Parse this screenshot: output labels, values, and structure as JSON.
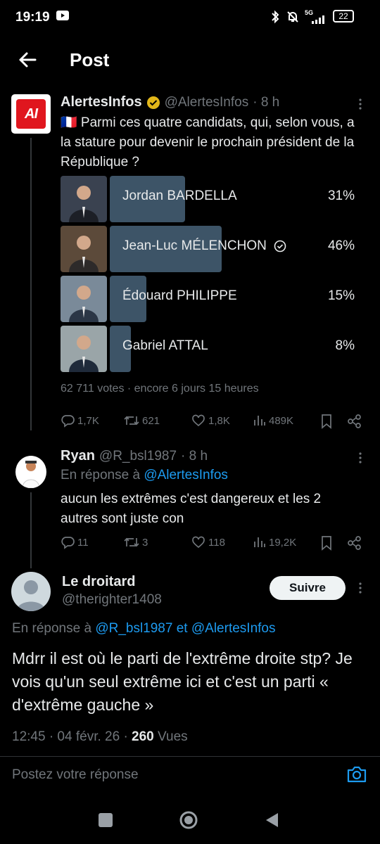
{
  "status_bar": {
    "time": "19:19",
    "network": "5G",
    "battery": "22"
  },
  "header": {
    "title": "Post"
  },
  "tweet": {
    "author_name": "AlertesInfos",
    "handle": "@AlertesInfos",
    "time": "· 8 h",
    "avatar_text": "AI",
    "text": "🇫🇷 Parmi ces quatre candidats, qui, selon vous, a la stature pour devenir le prochain président de la République ?",
    "poll": {
      "options": [
        {
          "label": "Jordan BARDELLA",
          "pct": "31%",
          "value": 31,
          "selected": false
        },
        {
          "label": "Jean-Luc MÉLENCHON",
          "pct": "46%",
          "value": 46,
          "selected": true
        },
        {
          "label": "Édouard PHILIPPE",
          "pct": "15%",
          "value": 15,
          "selected": false
        },
        {
          "label": "Gabriel ATTAL",
          "pct": "8%",
          "value": 8,
          "selected": false
        }
      ],
      "meta": "62 711 votes · encore 6 jours 15 heures"
    },
    "actions": {
      "replies": "1,7K",
      "retweets": "621",
      "likes": "1,8K",
      "views": "489K"
    }
  },
  "reply1": {
    "author_name": "Ryan",
    "handle": "@R_bsl1987",
    "time": "· 8 h",
    "reply_prefix": "En réponse à",
    "reply_to": "@AlertesInfos",
    "text": "aucun les extrêmes c'est dangereux et les 2 autres sont juste con",
    "actions": {
      "replies": "11",
      "retweets": "3",
      "likes": "118",
      "views": "19,2K"
    }
  },
  "main_reply": {
    "author_name": "Le droitard",
    "handle": "@therighter1408",
    "follow_label": "Suivre",
    "reply_prefix": "En réponse à",
    "reply_to_1": "@R_bsl1987",
    "reply_joiner": "et",
    "reply_to_2": "@AlertesInfos",
    "text": "Mdrr il est où le parti de l'extrême droite stp? Je vois qu'un seul extrême ici et c'est un parti « d'extrême gauche »",
    "timestamp": "12:45 · 04 févr. 26 ·",
    "views_count": "260",
    "views_label": "Vues"
  },
  "composer": {
    "placeholder": "Postez votre réponse"
  }
}
